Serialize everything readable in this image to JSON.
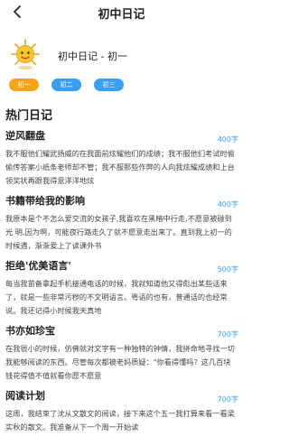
{
  "navbar": {
    "title": "初中日记",
    "back_icon": "chevron-left-icon"
  },
  "header": {
    "title": "初中日记 - 初一",
    "cover_icon": "cartoon-sun-icon"
  },
  "tabs": [
    {
      "label": "初一",
      "active": true
    },
    {
      "label": "初二",
      "active": false
    },
    {
      "label": "初三",
      "active": false
    }
  ],
  "section": {
    "title": "热门日记"
  },
  "diaries": [
    {
      "title": "逆风翻盘",
      "count": "400字",
      "summary": "我不服他们耀武扬威的在我面前炫耀他们的成绩；我不服他们考试时偷偷传答案小纸条老师却不管；我不服那些作弊的人向我炫耀成绩和上台领奖状再跟我得意洋洋地炫"
    },
    {
      "title": "书籍带给我的影响",
      "count": "400字",
      "summary": "我原本是个不怎么爱交流的女孩子,我喜欢在黑暗中行走,不愿意被碰到光 明,因为啊，可能夜行路走久了就不愿意走出来了。直到我上初一的时候遇，渐渐爱上了读课外书"
    },
    {
      "title": "拒绝'优美语言'",
      "count": "500字",
      "summary": "每当我苗备拿起手机接通电话的时候，我就知道他又得彪出某些话来了，就是一些非常污秽的不文明语言。粤语的也有，普通话的也经常说。我还记得小时候我天真地"
    },
    {
      "title": "书亦如珍宝",
      "count": "700字",
      "summary": "在我很小的时候，仿佛就对文字有一种独特的钟情，我拼命地寻找一切我能够阅读的东西。尽管每次都被老妈质疑：\"你看得懂吗？这几百块钱花得值不值就看你愿不愿意"
    },
    {
      "title": "阅读计划",
      "count": "700字",
      "summary": "这周，我结束了沈从文散文的阅读，接下来这个五一我打算来看一看梁实秋的散文。我准备从下一个周一开始读"
    }
  ],
  "colors": {
    "accent_orange": "#f6a51b",
    "accent_blue": "#3a9ff2"
  }
}
